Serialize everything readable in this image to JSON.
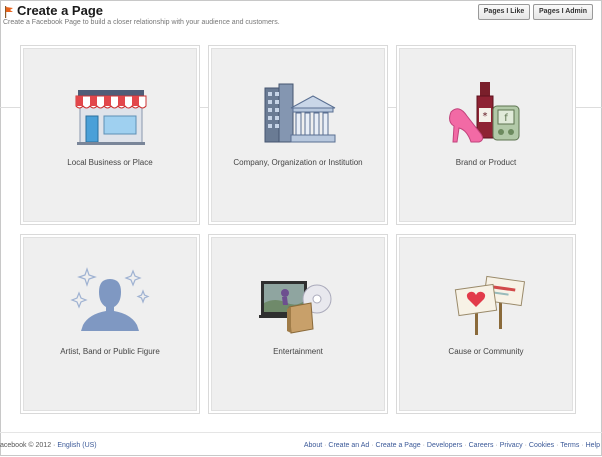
{
  "header": {
    "title": "Create a Page",
    "subtitle": "Create a Facebook Page to build a closer relationship with your audience and customers.",
    "buttons": [
      "Pages I Like",
      "Pages I Admin"
    ]
  },
  "categories": [
    {
      "label": "Local Business or Place",
      "icon": "storefront-icon"
    },
    {
      "label": "Company, Organization or Institution",
      "icon": "office-buildings-icon"
    },
    {
      "label": "Brand or Product",
      "icon": "products-icon"
    },
    {
      "label": "Artist, Band or Public Figure",
      "icon": "person-silhouette-icon"
    },
    {
      "label": "Entertainment",
      "icon": "tv-film-icon"
    },
    {
      "label": "Cause or Community",
      "icon": "protest-signs-icon"
    }
  ],
  "footer": {
    "copyright": "acebook © 2012 ·",
    "language": "English (US)",
    "links": [
      "About",
      "Create an Ad",
      "Create a Page",
      "Developers",
      "Careers",
      "Privacy",
      "Cookies",
      "Terms",
      "Help"
    ]
  }
}
